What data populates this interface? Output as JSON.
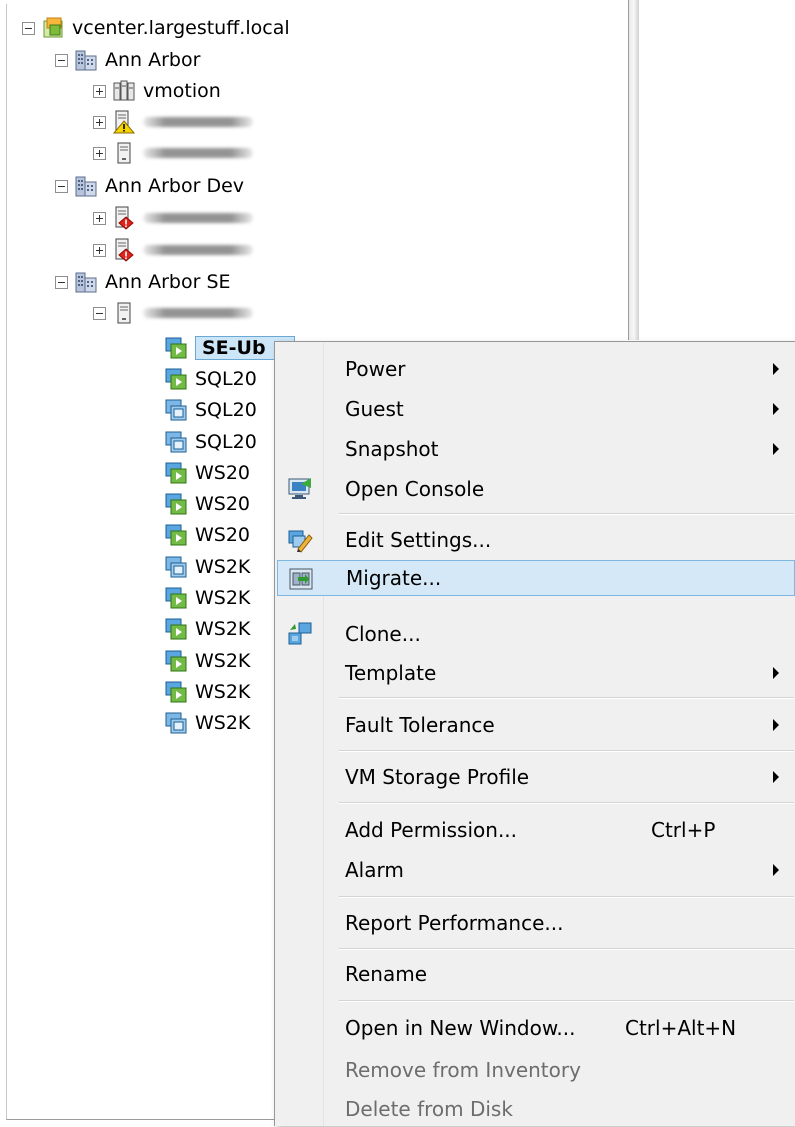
{
  "tree": {
    "root": {
      "label": "vcenter.largestuff.local"
    },
    "datacenters": [
      {
        "label": "Ann Arbor",
        "children": [
          {
            "label": "vmotion"
          }
        ]
      },
      {
        "label": "Ann Arbor Dev"
      },
      {
        "label": "Ann Arbor SE"
      }
    ],
    "vms": [
      {
        "label": "SE-Ub"
      },
      {
        "label": "SQL20"
      },
      {
        "label": "SQL20"
      },
      {
        "label": "SQL20"
      },
      {
        "label": "WS20"
      },
      {
        "label": "WS20"
      },
      {
        "label": "WS20"
      },
      {
        "label": "WS2K"
      },
      {
        "label": "WS2K"
      },
      {
        "label": "WS2K"
      },
      {
        "label": "WS2K"
      },
      {
        "label": "WS2K"
      },
      {
        "label": "WS2K"
      }
    ]
  },
  "context_menu": {
    "items": [
      {
        "label": "Power",
        "submenu": true
      },
      {
        "label": "Guest",
        "submenu": true
      },
      {
        "label": "Snapshot",
        "submenu": true
      },
      {
        "label": "Open Console",
        "icon": "console-icon"
      },
      {
        "label": "Edit Settings...",
        "icon": "edit-settings-icon"
      },
      {
        "label": "Migrate...",
        "icon": "migrate-icon",
        "highlighted": true
      },
      {
        "label": "Clone...",
        "icon": "clone-icon"
      },
      {
        "label": "Template",
        "submenu": true
      },
      {
        "label": "Fault Tolerance",
        "submenu": true
      },
      {
        "label": "VM Storage Profile",
        "submenu": true
      },
      {
        "label": "Add Permission...",
        "shortcut": "Ctrl+P"
      },
      {
        "label": "Alarm",
        "submenu": true
      },
      {
        "label": "Report Performance..."
      },
      {
        "label": "Rename"
      },
      {
        "label": "Open in New Window...",
        "shortcut": "Ctrl+Alt+N"
      },
      {
        "label": "Remove from Inventory",
        "disabled": true
      },
      {
        "label": "Delete from Disk",
        "disabled": true
      }
    ]
  },
  "colors": {
    "selection_bg": "#cde6f7",
    "menu_bg": "#f0f0f0",
    "menu_highlight": "#d5e8f7"
  }
}
